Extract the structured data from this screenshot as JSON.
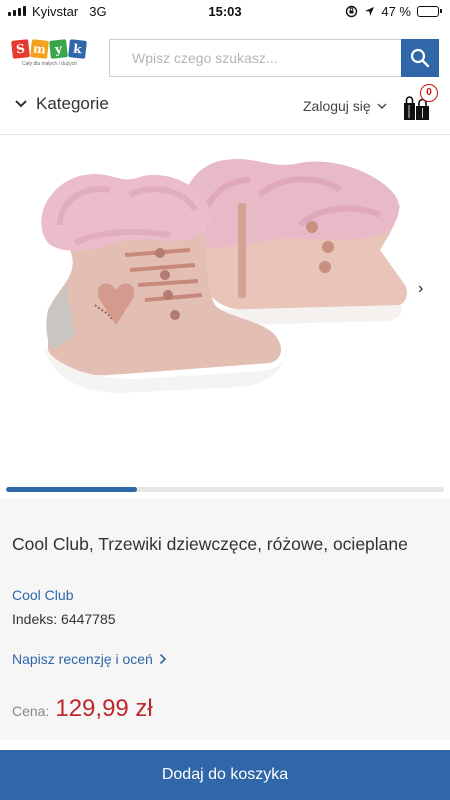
{
  "status_bar": {
    "carrier": "Kyivstar",
    "network": "3G",
    "time": "15:03",
    "battery": "47 %",
    "battery_level": 0.47
  },
  "header": {
    "logo_letters": [
      "S",
      "m",
      "y",
      "k"
    ],
    "logo_colors": [
      "#e8392f",
      "#f4a21d",
      "#3aa64a",
      "#2f67a8"
    ],
    "logo_tagline": "Cały dla małych i dużych",
    "search_placeholder": "Wpisz czego szukasz...",
    "search_icon": "search-icon",
    "accent_color": "#2f67a8"
  },
  "nav": {
    "categories_label": "Kategorie",
    "login_label": "Zaloguj się",
    "cart_count": "0"
  },
  "gallery": {
    "image_alt": "pink-fur-ankle-boots",
    "next_icon": "›",
    "slide_progress": 0.3
  },
  "product": {
    "title": "Cool Club, Trzewiki dziewczęce, różowe, ocieplane",
    "brand": "Cool Club",
    "index_label": "Indeks",
    "index_value": "6447785",
    "review_link": "Napisz recenzję i oceń",
    "price_label": "Cena:",
    "price": "129,99 zł",
    "price_color": "#c0272d"
  },
  "cta": {
    "add_to_cart_label": "Dodaj do koszyka"
  }
}
